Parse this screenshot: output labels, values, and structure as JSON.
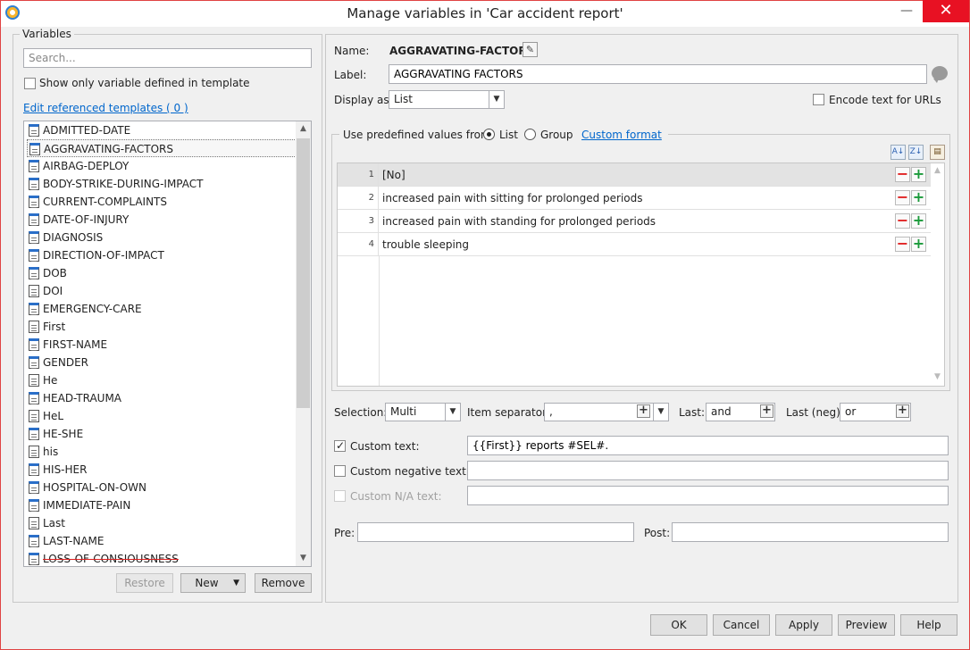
{
  "window": {
    "title": "Manage variables in 'Car accident report'",
    "minimize_glyph": "—",
    "close_glyph": "✕"
  },
  "variables_panel": {
    "legend": "Variables",
    "search_placeholder": "Search...",
    "show_only_label": "Show only variable defined in template",
    "edit_ref_link": "Edit referenced templates ( 0 )",
    "items": [
      {
        "label": "ADMITTED-DATE",
        "icon": "list-variable-icon"
      },
      {
        "label": "AGGRAVATING-FACTORS",
        "icon": "list-variable-icon",
        "selected": true
      },
      {
        "label": "AIRBAG-DEPLOY",
        "icon": "list-variable-icon"
      },
      {
        "label": "BODY-STRIKE-DURING-IMPACT",
        "icon": "list-variable-icon"
      },
      {
        "label": "CURRENT-COMPLAINTS",
        "icon": "list-variable-icon"
      },
      {
        "label": "DATE-OF-INJURY",
        "icon": "list-variable-icon"
      },
      {
        "label": "DIAGNOSIS",
        "icon": "list-variable-icon"
      },
      {
        "label": "DIRECTION-OF-IMPACT",
        "icon": "list-variable-icon"
      },
      {
        "label": "DOB",
        "icon": "list-variable-icon"
      },
      {
        "label": "DOI",
        "icon": "text-variable-icon"
      },
      {
        "label": "EMERGENCY-CARE",
        "icon": "list-variable-icon"
      },
      {
        "label": "First",
        "icon": "text-variable-icon"
      },
      {
        "label": "FIRST-NAME",
        "icon": "list-variable-icon"
      },
      {
        "label": "GENDER",
        "icon": "list-variable-icon"
      },
      {
        "label": "He",
        "icon": "text-variable-icon"
      },
      {
        "label": "HEAD-TRAUMA",
        "icon": "list-variable-icon"
      },
      {
        "label": "HeL",
        "icon": "text-variable-icon"
      },
      {
        "label": "HE-SHE",
        "icon": "list-variable-icon"
      },
      {
        "label": "his",
        "icon": "text-variable-icon"
      },
      {
        "label": "HIS-HER",
        "icon": "list-variable-icon"
      },
      {
        "label": "HOSPITAL-ON-OWN",
        "icon": "list-variable-icon"
      },
      {
        "label": "IMMEDIATE-PAIN",
        "icon": "list-variable-icon"
      },
      {
        "label": "Last",
        "icon": "text-variable-icon"
      },
      {
        "label": "LAST-NAME",
        "icon": "list-variable-icon"
      },
      {
        "label": "LOSS-OF-CONSIOUSNESS",
        "icon": "list-variable-icon",
        "strike": true
      }
    ],
    "restore_label": "Restore",
    "new_label": "New",
    "remove_label": "Remove"
  },
  "details": {
    "name_label": "Name:",
    "name_value": "AGGRAVATING-FACTORS",
    "label_label": "Label:",
    "label_value": "AGGRAVATING FACTORS",
    "display_as_label": "Display as:",
    "display_as_value": "List",
    "encode_label": "Encode text for URLs",
    "predefined_label": "Use predefined values from:",
    "radio_list": "List",
    "radio_group": "Group",
    "custom_format_link": "Custom format",
    "values": [
      {
        "n": "1",
        "text": "[No]"
      },
      {
        "n": "2",
        "text": "increased pain with sitting for prolonged periods"
      },
      {
        "n": "3",
        "text": "increased pain with standing for prolonged periods"
      },
      {
        "n": "4",
        "text": "trouble sleeping"
      }
    ],
    "selection_label": "Selection:",
    "selection_value": "Multi",
    "item_sep_label": "Item separator:",
    "item_sep_value": ",",
    "last_label": "Last:",
    "last_value": "and",
    "last_neg_label": "Last (neg):",
    "last_neg_value": "or",
    "custom_text_label": "Custom text:",
    "custom_text_value": "{{First}} reports #SEL#.",
    "custom_neg_label": "Custom negative text:",
    "custom_neg_value": "",
    "custom_na_label": "Custom N/A text:",
    "custom_na_value": "",
    "pre_label": "Pre:",
    "pre_value": "",
    "post_label": "Post:",
    "post_value": ""
  },
  "footer": {
    "ok": "OK",
    "cancel": "Cancel",
    "apply": "Apply",
    "preview": "Preview",
    "help": "Help"
  }
}
